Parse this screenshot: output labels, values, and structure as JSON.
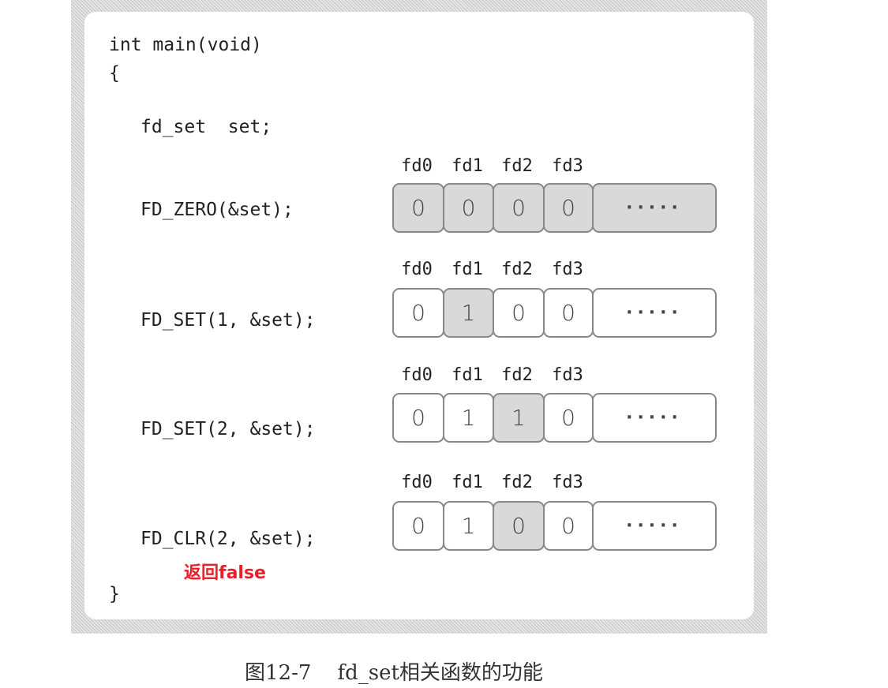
{
  "code": {
    "line1": "int main(void)",
    "open_brace": "{",
    "decl": "fd_set  set;",
    "close_brace": "}"
  },
  "fd_labels": [
    "fd0",
    "fd1",
    "fd2",
    "fd3"
  ],
  "rows": [
    {
      "call": "FD_ZERO(&set);",
      "cells": [
        "0",
        "0",
        "0",
        "0",
        "·····"
      ],
      "highlighted": [
        0,
        1,
        2,
        3,
        4
      ]
    },
    {
      "call": "FD_SET(1, &set);",
      "cells": [
        "0",
        "1",
        "0",
        "0",
        "·····"
      ],
      "highlighted": [
        1
      ]
    },
    {
      "call": "FD_SET(2, &set);",
      "cells": [
        "0",
        "1",
        "1",
        "0",
        "·····"
      ],
      "highlighted": [
        2
      ]
    },
    {
      "call": "FD_CLR(2, &set);",
      "cells": [
        "0",
        "1",
        "0",
        "0",
        "·····"
      ],
      "highlighted": [
        2
      ]
    }
  ],
  "note": "返回false",
  "note_color": "#e8202a",
  "caption": "图12-7    fd_set相关函数的功能"
}
